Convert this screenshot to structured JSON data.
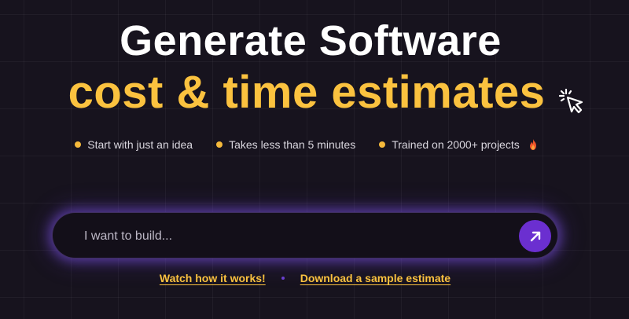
{
  "hero": {
    "title_line1": "Generate Software",
    "title_line2": "cost & time estimates"
  },
  "features": [
    {
      "label": "Start with just an idea"
    },
    {
      "label": "Takes less than 5 minutes"
    },
    {
      "label": "Trained on 2000+ projects",
      "icon": "fire-icon"
    }
  ],
  "search": {
    "placeholder": "I want to build...",
    "value": "",
    "submit_icon": "arrow-up-right-icon"
  },
  "links": {
    "watch": "Watch how it works!",
    "download": "Download a sample estimate"
  },
  "colors": {
    "background": "#17131e",
    "accent": "#fbc23f",
    "button": "#6b2fd0"
  },
  "decorations": {
    "cursor_icon": "click-cursor-icon"
  }
}
